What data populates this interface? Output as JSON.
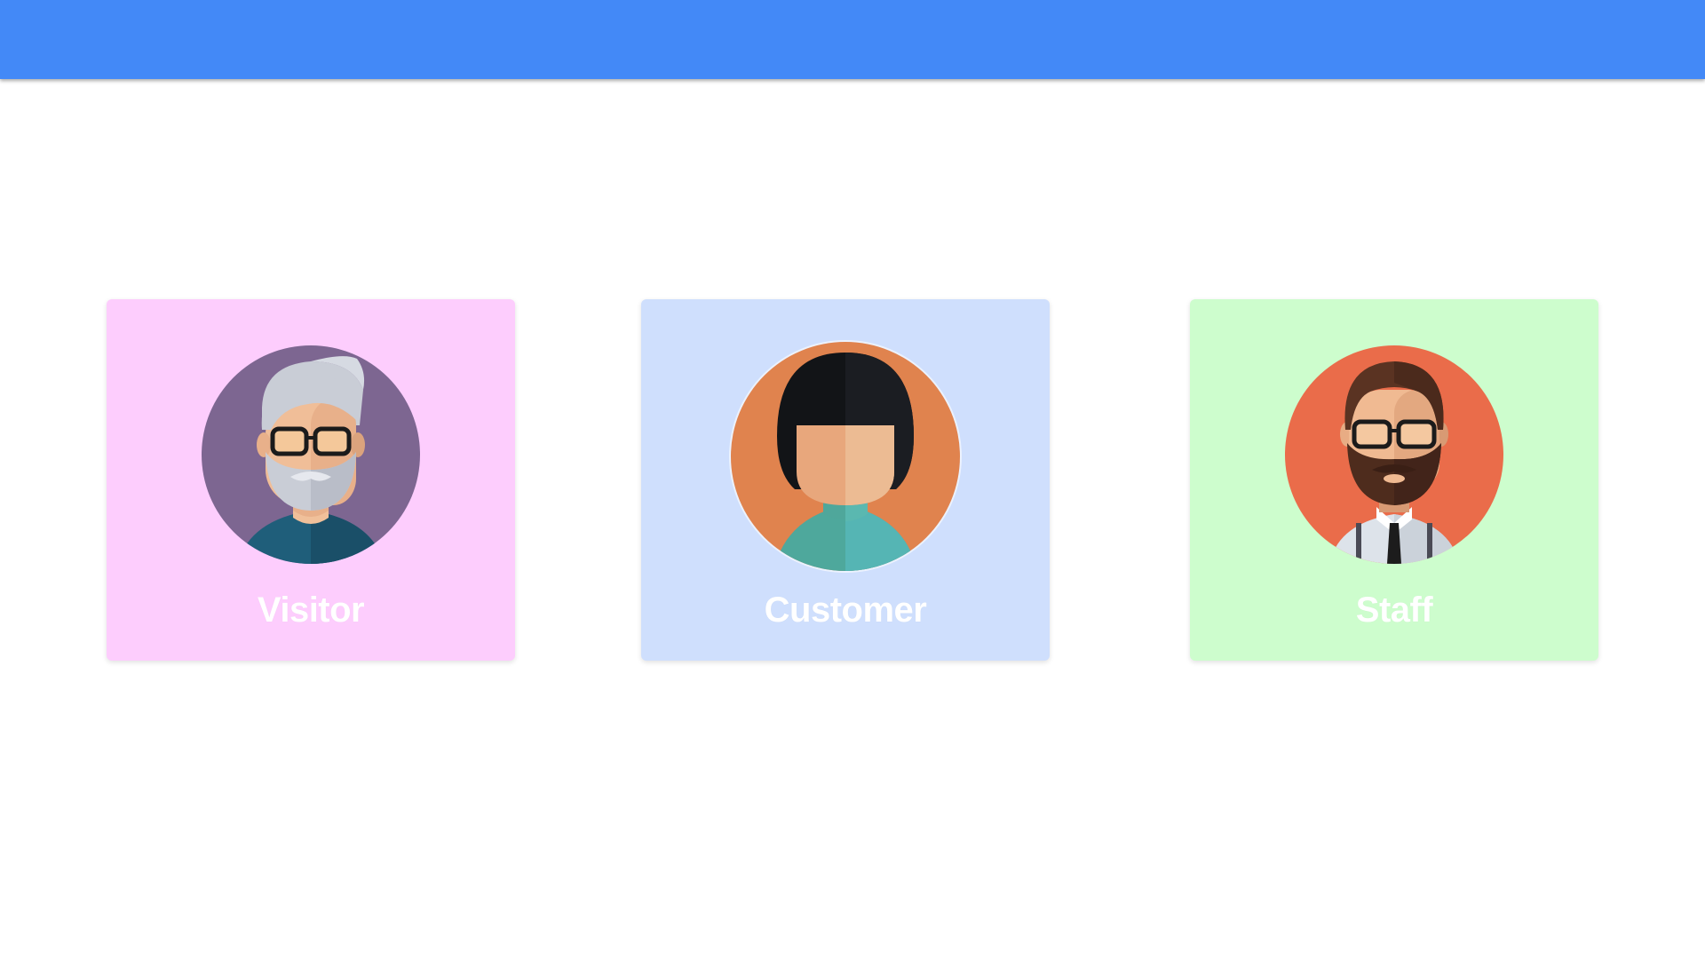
{
  "header": {
    "color": "#4389f7"
  },
  "cards": [
    {
      "id": "visitor",
      "label": "Visitor",
      "background": "#fdcdfd",
      "avatar": "elderly-man-avatar-icon",
      "avatar_bg": "#7d6691"
    },
    {
      "id": "customer",
      "label": "Customer",
      "background": "#cfdffd",
      "avatar": "woman-avatar-icon",
      "avatar_bg": "#e0834e"
    },
    {
      "id": "staff",
      "label": "Staff",
      "background": "#cdfdcd",
      "avatar": "bearded-man-avatar-icon",
      "avatar_bg": "#ea6c4a"
    }
  ]
}
